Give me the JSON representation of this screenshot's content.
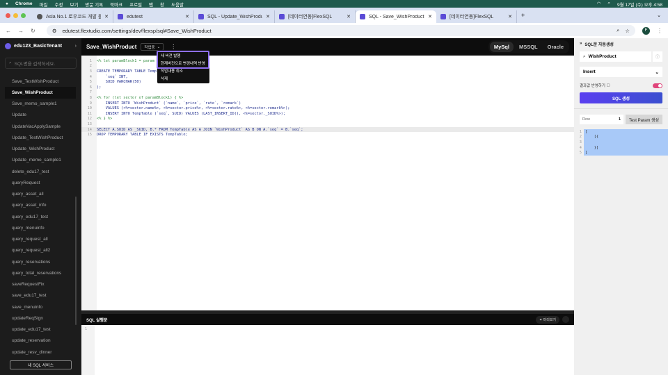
{
  "os_menubar": {
    "app": "Chrome",
    "items": [
      "파일",
      "수정",
      "보기",
      "방문 기록",
      "북마크",
      "프로필",
      "탭",
      "창",
      "도움말"
    ],
    "clock": "9월 17일 (수) 오후 4:58"
  },
  "browser": {
    "tabs": [
      {
        "title": "Asia No.1 로우코드 개발 플랫폼 |"
      },
      {
        "title": "edutest"
      },
      {
        "title": "SQL - Update_WishProduct"
      },
      {
        "title": "[데이터연동]FlexSQL"
      },
      {
        "title": "SQL - Save_WishProduct",
        "active": true
      },
      {
        "title": "[데이터연동]FlexSQL"
      }
    ],
    "url": "edutest.flextudio.com/settings/dev/flexsp/sql#Save_WishProduct",
    "profile_initial": "F"
  },
  "sidebar": {
    "tenant": "edu123_BasicTenant",
    "search_placeholder": "SQL명을 검색하세요.",
    "items": [
      "Save_TestWishProduct",
      "Save_WishProduct",
      "Save_memo_sample1",
      "Update",
      "UpdateVacApplySample",
      "Update_TestWishProduct",
      "Update_WishProduct",
      "Update_memo_sample1",
      "delete_edu17_test",
      "queryRequest",
      "query_asset_all",
      "query_asset_info",
      "query_edu17_test",
      "query_menuinfo",
      "query_request_all",
      "query_request_all2",
      "query_reservations",
      "query_total_reservations",
      "saveRequestFix",
      "save_edu17_test",
      "save_menuinfo",
      "updateReqSign",
      "update_edu17_test",
      "update_reservation",
      "update_resv_dinner"
    ],
    "active_index": 1,
    "new_button": "새 SQL 서비스"
  },
  "editor": {
    "title": "Save_WishProduct",
    "status": "작업중",
    "db_tabs": [
      "MySql",
      "MSSQL",
      "Oracle"
    ],
    "active_db": "MySql",
    "menu": [
      "새 버전 발행",
      "현재버전으로 변경내역 반영",
      "작업내용 취소",
      "삭제"
    ],
    "lines": [
      "<% let paramBlock1 = param",
      "",
      "CREATE TEMPORARY TABLE TempTable (",
      "    `seq` INT,",
      "    SUID VARCHAR(50)",
      ");",
      "",
      "<% for (let sector of paramBlock1) { %>",
      "    INSERT INTO `WishProduct` (`name`, `price`, `rate`, `remark`)",
      "    VALUES (<%=sector.name%>, <%=sector.price%>, <%=sector.rate%>, <%=sector.remark%>);",
      "    INSERT INTO TempTable (`seq`, SUID) VALUES (LAST_INSERT_ID(), <%=sector._SUID%>);",
      "<% } %>",
      "",
      "SELECT A.SUID AS _SUID, B.* FROM TempTable AS A JOIN `WishProduct` AS B ON A.`seq` = B.`seq`;",
      "DROP TEMPORARY TABLE IF EXISTS TempTable;"
    ],
    "highlight_line": 14
  },
  "result_pane": {
    "title": "SQL 실행문",
    "preview_label": "미리보기",
    "lines": [
      "1"
    ]
  },
  "right_panel": {
    "title": "SQL문 자동생성",
    "table_input": "WishProduct",
    "operation": "Insert",
    "toggle_label": "결과값 반영하기",
    "toggle_on": true,
    "generate_button": "SQL 생성",
    "row_label": "Row",
    "row_value": "1",
    "test_param_button": "Test Param 생성",
    "json_lines": [
      "[",
      "    [{",
      "",
      "    }]",
      "]"
    ]
  }
}
